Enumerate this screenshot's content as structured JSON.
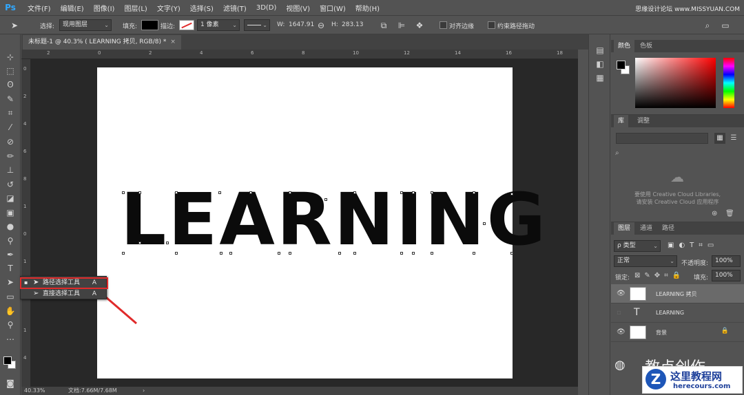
{
  "app": {
    "logo": "Ps"
  },
  "menu": [
    "文件(F)",
    "编辑(E)",
    "图像(I)",
    "图层(L)",
    "文字(Y)",
    "选择(S)",
    "滤镜(T)",
    "3D(D)",
    "视图(V)",
    "窗口(W)",
    "帮助(H)"
  ],
  "watermark_top": "思缘设计论坛 www.MISSYUAN.COM",
  "options": {
    "select_label": "选择:",
    "select_value": "现用图层",
    "fill_label": "填充:",
    "stroke_label": "描边:",
    "stroke_width": "1 像素",
    "w_label": "W:",
    "w_value": "1647.91",
    "h_label": "H:",
    "h_value": "283.13",
    "align_edges": "对齐边缘",
    "constrain_path": "约束路径拖动"
  },
  "document": {
    "tab_title": "未标题-1 @ 40.3% ( LEARNING 拷贝, RGB/8) *",
    "close": "×",
    "canvas_text": "LEARNING"
  },
  "ruler": {
    "h_ticks": [
      "2",
      "0",
      "2",
      "4",
      "6",
      "8",
      "10",
      "12",
      "14",
      "16",
      "18"
    ],
    "v_ticks": [
      "0",
      "2",
      "4",
      "6",
      "8",
      "1",
      "0",
      "1",
      "2",
      "1",
      "4"
    ]
  },
  "flyout": {
    "items": [
      {
        "label": "路径选择工具",
        "key": "A"
      },
      {
        "label": "直接选择工具",
        "key": "A"
      }
    ]
  },
  "status": {
    "zoom": "40.33%",
    "doc_size": "文档:7.66M/7.68M"
  },
  "panels": {
    "color_tabs": [
      "颜色",
      "色板"
    ],
    "library_tabs": [
      "库",
      "调整"
    ],
    "cc_message_line1": "要使用 Creative Cloud Libraries,",
    "cc_message_line2": "请安装 Creative Cloud 应用程序",
    "layer_tabs": [
      "图层",
      "通道",
      "路径"
    ],
    "kind_filter": "ρ 类型",
    "blend_mode": "正常",
    "opacity_label": "不透明度:",
    "opacity_value": "100%",
    "lock_label": "锁定:",
    "fill_label": "填充:",
    "fill_value": "100%",
    "layers": [
      {
        "name": "LEARNING 拷贝",
        "visible": true,
        "selected": true,
        "type": "shape"
      },
      {
        "name": "LEARNING",
        "visible": false,
        "selected": false,
        "type": "text"
      },
      {
        "name": "背景",
        "visible": true,
        "selected": false,
        "type": "background"
      }
    ]
  },
  "overlay": {
    "wechat": "教点创作",
    "site_name": "这里教程网",
    "site_url": "herecours.com"
  },
  "colors": {
    "accent_red": "#e02a2a",
    "ps_blue": "#31a8ff"
  }
}
